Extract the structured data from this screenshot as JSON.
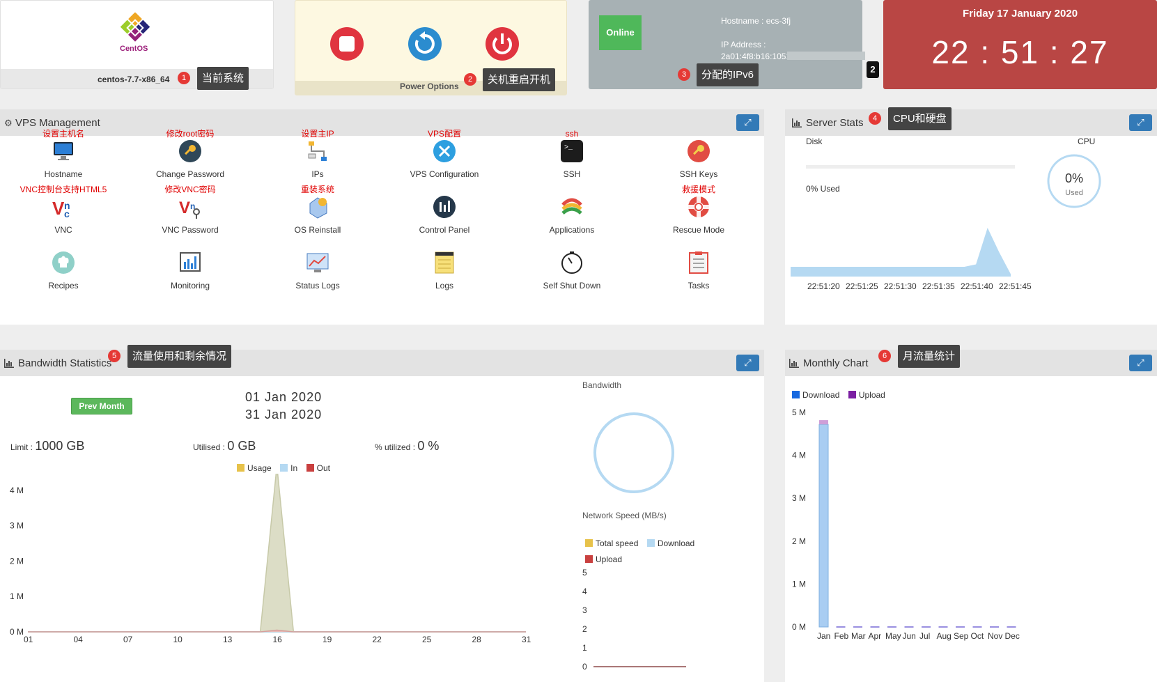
{
  "os_card": {
    "logo_text": "CentOS",
    "os_name": "centos-7.7-x86_64",
    "callout": "当前系统",
    "badge": "1"
  },
  "power_card": {
    "label": "Power Options",
    "callout": "关机重启开机",
    "badge": "2",
    "buttons": [
      "stop",
      "restart",
      "power"
    ]
  },
  "status_card": {
    "status": "Online",
    "hostname": "Hostname : ecs-3fj",
    "ip_label": "IP Address :",
    "ip_value": "2a01:4f8:b16:1051:",
    "callout": "分配的IPv6",
    "badge": "3",
    "square_badge": "2"
  },
  "date_card": {
    "date": "Friday 17 January 2020",
    "time": "22 : 51 : 27"
  },
  "vps_panel": {
    "title": "VPS Management",
    "tiles": [
      {
        "ann": "设置主机名",
        "label": "Hostname",
        "icon": "monitor-icon"
      },
      {
        "ann": "修改root密码",
        "label": "Change Password",
        "icon": "key-icon"
      },
      {
        "ann": "设置主IP",
        "label": "IPs",
        "icon": "network-icon"
      },
      {
        "ann": "VPS配置",
        "label": "VPS Configuration",
        "icon": "tools-icon"
      },
      {
        "ann": "ssh",
        "label": "SSH",
        "icon": "terminal-icon"
      },
      {
        "ann": "",
        "label": "SSH Keys",
        "icon": "ssh-key-icon"
      },
      {
        "ann": "VNC控制台支持HTML5",
        "label": "VNC",
        "icon": "vnc-icon"
      },
      {
        "ann": "修改VNC密码",
        "label": "VNC Password",
        "icon": "vnc-password-icon"
      },
      {
        "ann": "重装系统",
        "label": "OS Reinstall",
        "icon": "reinstall-icon"
      },
      {
        "ann": "",
        "label": "Control Panel",
        "icon": "control-panel-icon"
      },
      {
        "ann": "",
        "label": "Applications",
        "icon": "applications-icon"
      },
      {
        "ann": "救援模式",
        "label": "Rescue Mode",
        "icon": "lifebuoy-icon"
      },
      {
        "ann": "",
        "label": "Recipes",
        "icon": "chef-icon"
      },
      {
        "ann": "",
        "label": "Monitoring",
        "icon": "monitoring-icon"
      },
      {
        "ann": "",
        "label": "Status Logs",
        "icon": "status-logs-icon"
      },
      {
        "ann": "",
        "label": "Logs",
        "icon": "notepad-icon"
      },
      {
        "ann": "",
        "label": "Self Shut Down",
        "icon": "timer-icon"
      },
      {
        "ann": "",
        "label": "Tasks",
        "icon": "tasks-icon"
      }
    ]
  },
  "stats_panel": {
    "title": "Server Stats",
    "callout": "CPU和硬盘",
    "badge": "4",
    "disk_label": "Disk",
    "disk_used": "0% Used",
    "cpu_label": "CPU",
    "cpu_percent": "0%",
    "cpu_used": "Used",
    "time_ticks": [
      "22:51:20",
      "22:51:25",
      "22:51:30",
      "22:51:35",
      "22:51:40",
      "22:51:45"
    ]
  },
  "bw_panel": {
    "title": "Bandwidth Statistics",
    "callout": "流量使用和剩余情况",
    "badge": "5",
    "prev_month": "Prev Month",
    "date_from": "01 Jan 2020",
    "date_to": "31 Jan 2020",
    "limit_label": "Limit :",
    "limit_value": "1000 GB",
    "utilised_label": "Utilised :",
    "utilised_value": "0 GB",
    "pct_label": "% utilized :",
    "pct_value": "0 %",
    "legend": [
      "Usage",
      "In",
      "Out"
    ],
    "bandwidth_label": "Bandwidth",
    "network_speed_label": "Network Speed (MB/s)",
    "speed_legend": [
      "Total speed",
      "Download",
      "Upload"
    ]
  },
  "month_panel": {
    "title": "Monthly Chart",
    "callout": "月流量统计",
    "badge": "6",
    "legend": [
      "Download",
      "Upload"
    ]
  },
  "colors": {
    "usage": "#e7c24a",
    "in": "#b5d9f2",
    "out": "#c9403f",
    "download": "#1769e0",
    "upload": "#7b1fa2",
    "accent": "#337ab7"
  },
  "chart_data": [
    {
      "type": "area",
      "title": "Bandwidth Statistics",
      "x": [
        "01",
        "04",
        "07",
        "10",
        "13",
        "16",
        "19",
        "22",
        "25",
        "28",
        "31"
      ],
      "y_ticks": [
        "0 M",
        "1 M",
        "2 M",
        "3 M",
        "4 M",
        "5 M"
      ],
      "ylim": [
        0,
        5
      ],
      "series": [
        {
          "name": "Usage",
          "points": [
            [
              1,
              0
            ],
            [
              15,
              0
            ],
            [
              16,
              4.7
            ],
            [
              17,
              0
            ],
            [
              31,
              0
            ]
          ]
        },
        {
          "name": "In",
          "points": [
            [
              1,
              0
            ],
            [
              31,
              0
            ]
          ]
        },
        {
          "name": "Out",
          "points": [
            [
              1,
              0
            ],
            [
              15,
              0
            ],
            [
              16,
              0.05
            ],
            [
              17,
              0
            ],
            [
              31,
              0
            ]
          ]
        }
      ],
      "grid": false,
      "legend": "top"
    },
    {
      "type": "area",
      "title": "Server Stats",
      "x": [
        "22:51:20",
        "22:51:25",
        "22:51:30",
        "22:51:35",
        "22:51:40",
        "22:51:45"
      ],
      "series": [
        {
          "name": "CPU",
          "values": [
            0.2,
            0.2,
            0.2,
            0.2,
            0.2,
            0.2,
            0.2,
            0.2,
            0.2,
            0.2,
            0.2,
            0.2,
            0.2,
            0.2,
            0.2,
            0.2,
            0.25,
            1.0,
            0.5,
            0.05
          ]
        }
      ]
    },
    {
      "type": "line",
      "title": "Network Speed (MB/s)",
      "y_ticks": [
        "0",
        "1",
        "2",
        "3",
        "4",
        "5"
      ],
      "ylim": [
        0,
        5
      ],
      "series": [
        {
          "name": "Total speed",
          "values": [
            0,
            0
          ]
        },
        {
          "name": "Download",
          "values": [
            0,
            0
          ]
        },
        {
          "name": "Upload",
          "values": [
            0,
            0
          ]
        }
      ]
    },
    {
      "type": "bar",
      "title": "Monthly Chart",
      "categories": [
        "Jan",
        "Feb",
        "Mar",
        "Apr",
        "May",
        "Jun",
        "Jul",
        "Aug",
        "Sep",
        "Oct",
        "Nov",
        "Dec"
      ],
      "y_ticks": [
        "0 M",
        "1 M",
        "2 M",
        "3 M",
        "4 M",
        "5 M"
      ],
      "ylim": [
        0,
        5
      ],
      "series": [
        {
          "name": "Download",
          "values": [
            4.72,
            0,
            0,
            0,
            0,
            0,
            0,
            0,
            0,
            0,
            0,
            0
          ]
        },
        {
          "name": "Upload",
          "values": [
            0.1,
            0,
            0,
            0,
            0,
            0,
            0,
            0,
            0,
            0,
            0,
            0
          ]
        }
      ],
      "legend": "top-left"
    }
  ]
}
